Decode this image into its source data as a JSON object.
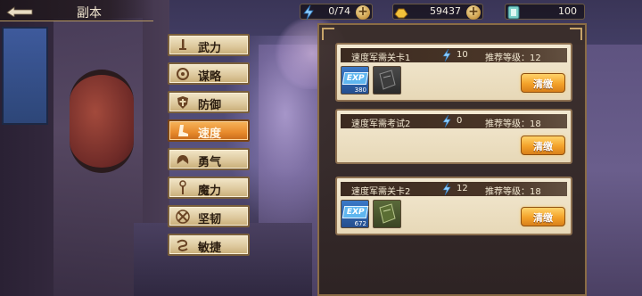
{
  "header": {
    "title": "副本",
    "back_icon": "back-arrow-icon"
  },
  "resources": {
    "stamina": {
      "value": "0/74",
      "icon": "lightning-icon"
    },
    "gold": {
      "value": "59437",
      "icon": "gold-ingot-icon"
    },
    "tickets": {
      "value": "100",
      "icon": "ticket-icon"
    }
  },
  "categories": [
    {
      "label": "武力",
      "icon": "sword-icon",
      "active": false
    },
    {
      "label": "谋略",
      "icon": "brain-icon",
      "active": false
    },
    {
      "label": "防御",
      "icon": "shield-icon",
      "active": false
    },
    {
      "label": "速度",
      "icon": "boot-icon",
      "active": true
    },
    {
      "label": "勇气",
      "icon": "wings-icon",
      "active": false
    },
    {
      "label": "魔力",
      "icon": "staff-icon",
      "active": false
    },
    {
      "label": "坚韧",
      "icon": "cross-swords-icon",
      "active": false
    },
    {
      "label": "敏捷",
      "icon": "wind-icon",
      "active": false
    }
  ],
  "stages": [
    {
      "name": "速度军需关卡1",
      "cost": "10",
      "recommend": "推荐等级：12",
      "exp_qty": "380",
      "sweep": "清缴"
    },
    {
      "name": "速度军需考试2",
      "cost": "0",
      "recommend": "推荐等级：18",
      "sweep": "清缴"
    },
    {
      "name": "速度军需关卡2",
      "cost": "12",
      "recommend": "推荐等级：18",
      "exp_qty": "672",
      "sweep": "清缴"
    }
  ],
  "colors": {
    "active_category": "#e88a2c",
    "card_bg": "#f3e9d2",
    "sweep_button": "#f3a22a"
  }
}
